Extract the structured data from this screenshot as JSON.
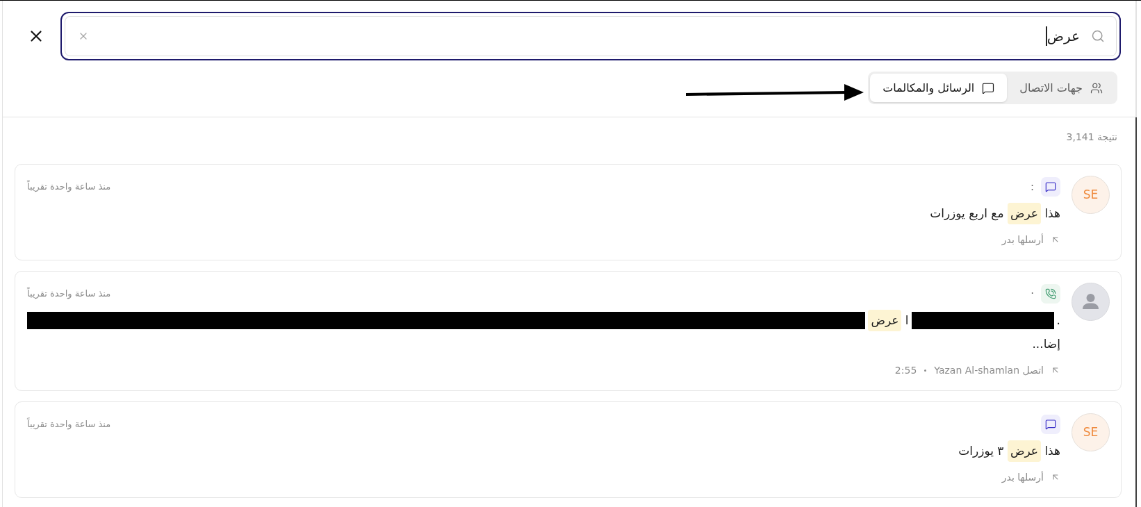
{
  "search": {
    "value": "عرض",
    "focused": true
  },
  "tabs": [
    {
      "kind": "contacts",
      "label": "جهات الاتصال",
      "selected": false
    },
    {
      "kind": "messages",
      "label": "الرسائل والمكالمات",
      "selected": true
    }
  ],
  "results_count": "3,141 نتيجة",
  "results": [
    {
      "avatar": {
        "kind": "initials",
        "text": "SE"
      },
      "kind": "message",
      "title": ":",
      "time": "منذ ساعة واحدة تقريباً",
      "lines": [
        [
          {
            "kind": "text",
            "runs": [
              {
                "text": "هذا ",
                "highlight": false
              },
              {
                "text": "عرض",
                "highlight": true
              },
              {
                "text": " مع اربع يوزرات",
                "highlight": false
              }
            ]
          }
        ]
      ],
      "footer": [
        "أرسلها بدر"
      ]
    },
    {
      "avatar": {
        "kind": "placeholder"
      },
      "kind": "call",
      "title": "·",
      "time": "منذ ساعة واحدة تقريباً",
      "lines": [
        [
          {
            "kind": "text",
            "runs": [
              {
                "text": ".",
                "highlight": false
              }
            ]
          },
          {
            "kind": "redacted"
          },
          {
            "kind": "text",
            "runs": [
              {
                "text": "ا ",
                "highlight": false
              },
              {
                "text": "عرض",
                "highlight": true
              }
            ]
          },
          {
            "kind": "redacted"
          }
        ],
        [
          {
            "kind": "text",
            "runs": [
              {
                "text": "إضا...",
                "highlight": false
              }
            ]
          }
        ]
      ],
      "footer": [
        "اتصل Yazan Al-shamlan",
        "2:55"
      ]
    },
    {
      "avatar": {
        "kind": "initials",
        "text": "SE"
      },
      "kind": "message",
      "time": "منذ ساعة واحدة تقريباً",
      "lines": [
        [
          {
            "kind": "text",
            "runs": [
              {
                "text": "هذا ",
                "highlight": false
              },
              {
                "text": "عرض",
                "highlight": true
              },
              {
                "text": " ٣ يوزرات",
                "highlight": false
              }
            ]
          }
        ]
      ],
      "footer": [
        "أرسلها بدر"
      ]
    }
  ]
}
